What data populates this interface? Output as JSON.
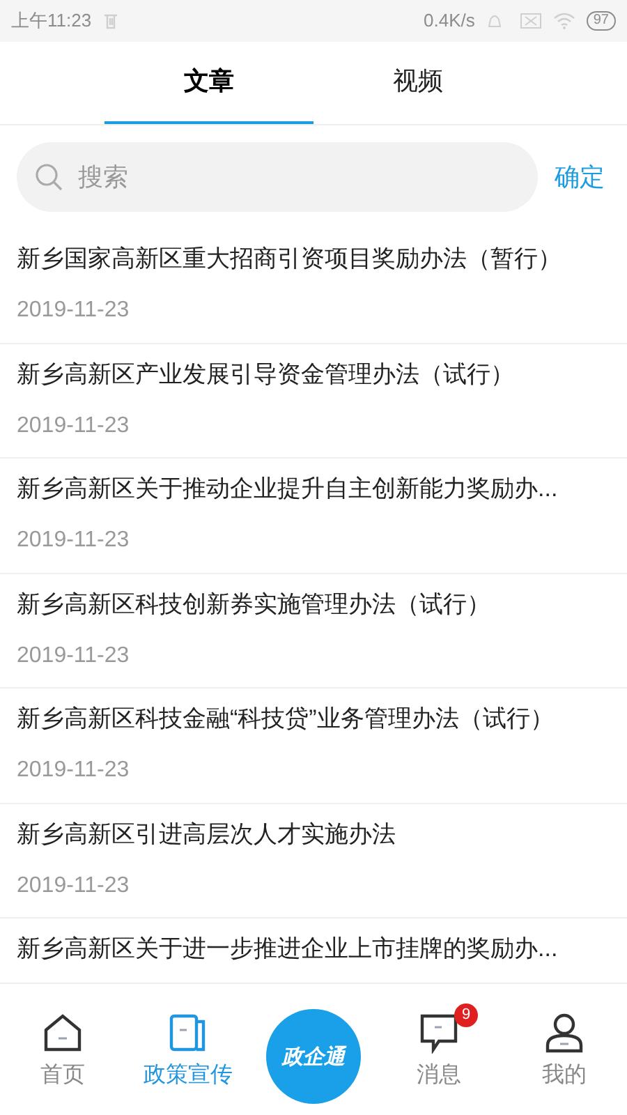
{
  "status_bar": {
    "time": "上午11:23",
    "speed": "0.4K/s",
    "battery": "97"
  },
  "tabs": [
    {
      "label": "文章",
      "selected": true
    },
    {
      "label": "视频",
      "selected": false
    }
  ],
  "search": {
    "placeholder": "搜索",
    "button": "确定"
  },
  "articles": [
    {
      "title": "新乡国家高新区重大招商引资项目奖励办法（暂行）",
      "date": "2019-11-23"
    },
    {
      "title": "新乡高新区产业发展引导资金管理办法（试行）",
      "date": "2019-11-23"
    },
    {
      "title": "新乡高新区关于推动企业提升自主创新能力奖励办...",
      "date": "2019-11-23"
    },
    {
      "title": "新乡高新区科技创新券实施管理办法（试行）",
      "date": "2019-11-23"
    },
    {
      "title": "新乡高新区科技金融“科技贷”业务管理办法（试行）",
      "date": "2019-11-23"
    },
    {
      "title": "新乡高新区引进高层次人才实施办法",
      "date": "2019-11-23"
    },
    {
      "title": "新乡高新区关于进一步推进企业上市挂牌的奖励办..."
    }
  ],
  "nav": [
    {
      "kind": "home",
      "label": "首页",
      "selected": false
    },
    {
      "kind": "policy",
      "label": "政策宣传",
      "selected": true
    },
    {
      "kind": "center",
      "label": "政企通"
    },
    {
      "kind": "message",
      "label": "消息",
      "selected": false,
      "badge": "9"
    },
    {
      "kind": "me",
      "label": "我的",
      "selected": false
    }
  ]
}
